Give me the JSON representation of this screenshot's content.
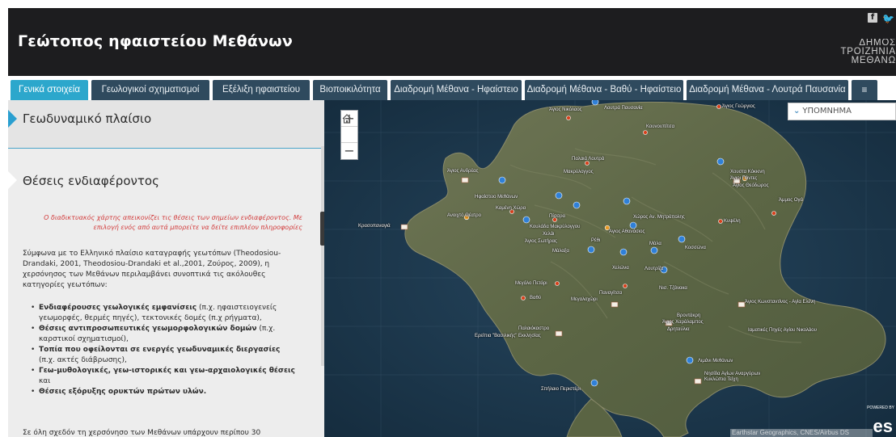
{
  "header": {
    "title": "Γεώτοπος ηφαιστείου Μεθάνων",
    "social": {
      "facebook_icon": "facebook-icon",
      "twitter_icon": "twitter-icon"
    },
    "logo": {
      "line1": "ΔΗΜΟΣ",
      "line2": "ΤΡΟΙΖΗΝΙΑ",
      "line3": "ΜΕΘΑΝΩ"
    }
  },
  "tabs": [
    {
      "label": "Γενικά στοιχεία",
      "active": true
    },
    {
      "label": "Γεωλογικοί σχηματισμοί"
    },
    {
      "label": "Εξέλιξη ηφαιστείου"
    },
    {
      "label": "Βιοποικιλότητα"
    },
    {
      "label": "Διαδρομή Μέθανα - Ηφαίστειο"
    },
    {
      "label": "Διαδρομή Μέθανα - Βαθύ - Ηφαίστειο"
    },
    {
      "label": "Διαδρομή Μέθανα - Λουτρά Παυσανία"
    },
    {
      "label": "≡",
      "icon": "menu-icon"
    }
  ],
  "panel": {
    "section1_title": "Γεωδυναμικό πλαίσιο",
    "section2_title": "Θέσεις ενδιαφέροντος",
    "intro_note": "Ο διαδικτυακός χάρτης απεικονίζει τις θέσεις των σημείων ενδιαφέροντος. Με επιλογή ενός από αυτά μπορείτε να δείτε επιπλέον πληροφορίες",
    "body": "Σύμφωνα με το Ελληνικό πλαίσιο καταγραφής γεωτόπων (Theodosiou-Drandaki, 2001, Theodosiou-Drandaki et al.,2001, Ζούρος, 2009), η χερσόνησος των Μεθάνων περιλαμβάνει συνοπτικά τις ακόλουθες κατηγορίες γεωτόπων:",
    "bullets": [
      {
        "bold": "Ενδιαφέρουσες γεωλογικές εμφανίσεις",
        "rest": " (π.χ. ηφαιστειογενείς γεωμορφές, θερμές πηγές), τεκτονικές δομές (π.χ ρήγματα),"
      },
      {
        "bold": "Θέσεις αντιπροσωπευτικές γεωμορφολογικών δομών",
        "rest": " (π.χ. καρστικοί σχηματισμοί),"
      },
      {
        "bold": "Τοπία που οφείλονται σε ενεργές γεωδυναμικές διεργασίες",
        "rest": " (π.χ. ακτές διάβρωσης),"
      },
      {
        "bold": "Γεω-μυθολογικές, γεω-ιστορικές και γεω-αρχαιολογικές θέσεις",
        "rest": " και"
      },
      {
        "bold": "Θέσεις εξόρυξης ορυκτών πρώτων υλών.",
        "rest": ""
      }
    ],
    "footer": "Σε όλη σχεδόν τη χερσόνησο των Μεθάνων υπάρχουν περίπου 30"
  },
  "map": {
    "zoom_in": "+",
    "home_icon": "home-icon",
    "zoom_out": "−",
    "legend_label": "ΥΠΟΜΝΗΜΑ",
    "attribution": "Earthstar Geographics, CNES/Airbus DS",
    "powered": "POWERED BY",
    "esri": "es",
    "labels": [
      "Άγιος Νικόλαος",
      "Λουτρά Παυσανία",
      "Άγιος Γεώργιος",
      "Κουνουπίτσα",
      "Παλαιά Λουτρά",
      "Άγιος Ανδρέας",
      "Μακρύλογγος",
      "Χουστα Κόκκινη",
      "Άγιοι Πάντες",
      "Άγιος Θεόδωρος",
      "Ηφαίστειο Μεθάνων",
      "Καμένη Χώρα",
      "Άμμος Ογά",
      "Ανοιχτό Θέατρο",
      "Πίσσρα",
      "Κουλάδα Μακρύλογγου",
      "Χώρος Αν. Μητρόπολης",
      "Χελάι",
      "Άγιος Αθανάσιος",
      "Κυψέλη",
      "Κρασοπαναγιά",
      "Άγιος Σωτήρας",
      "Ρέθι",
      "Μάλα",
      "Κοσσώνα",
      "Μάλαξα",
      "Χελώνα",
      "Λουτρίζα",
      "Νισ. Τζάνακα",
      "Μεγάλο Πετάρι",
      "Βαθύ",
      "Παναγίτσα",
      "Μεγαλοχώρι",
      "Άγιος Κωνσταντίνος - Αγία Ελένη",
      "Βροντάκρη",
      "Άγιος Χαράλαμπος",
      "Δρηταύλια",
      "Ιαματικές Πηγές Αγίου Νικολάου",
      "Παλαιόκαστρο",
      "Ερείπια \"Βασιλικής\" Εκκλησίας",
      "Λιμάνι Μεθάνων",
      "Νησίδα Αγίων Αναργύρων",
      "Κυκλώπια Τείχη",
      "Σπήλαιο Περιστέρι"
    ]
  }
}
